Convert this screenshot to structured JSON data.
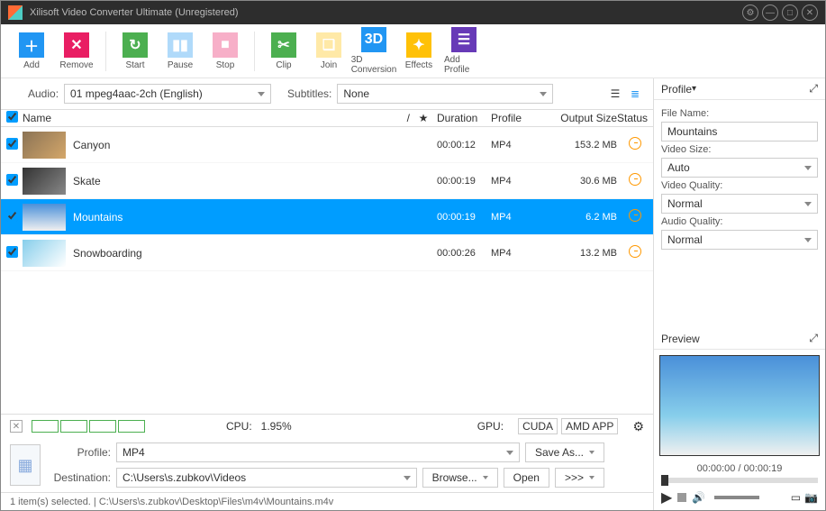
{
  "window": {
    "title": "Xilisoft Video Converter Ultimate (Unregistered)"
  },
  "toolbar": {
    "add": "Add",
    "remove": "Remove",
    "start": "Start",
    "pause": "Pause",
    "stop": "Stop",
    "clip": "Clip",
    "join": "Join",
    "threed": "3D Conversion",
    "effects": "Effects",
    "addprofile": "Add Profile"
  },
  "filters": {
    "audio_label": "Audio:",
    "audio_value": "01 mpeg4aac-2ch (English)",
    "subtitles_label": "Subtitles:",
    "subtitles_value": "None"
  },
  "columns": {
    "name": "Name",
    "path": "/",
    "star": "★",
    "duration": "Duration",
    "profile": "Profile",
    "output_size": "Output Size",
    "status": "Status"
  },
  "files": [
    {
      "name": "Canyon",
      "duration": "00:00:12",
      "profile": "MP4",
      "size": "153.2 MB",
      "selected": false,
      "checked": true
    },
    {
      "name": "Skate",
      "duration": "00:00:19",
      "profile": "MP4",
      "size": "30.6 MB",
      "selected": false,
      "checked": true
    },
    {
      "name": "Mountains",
      "duration": "00:00:19",
      "profile": "MP4",
      "size": "6.2 MB",
      "selected": true,
      "checked": true
    },
    {
      "name": "Snowboarding",
      "duration": "00:00:26",
      "profile": "MP4",
      "size": "13.2 MB",
      "selected": false,
      "checked": true
    }
  ],
  "usage": {
    "cpu_label": "CPU:",
    "cpu_value": "1.95%",
    "gpu_label": "GPU:",
    "cuda": "CUDA",
    "amd": "AMD APP"
  },
  "dest": {
    "profile_label": "Profile:",
    "profile_value": "MP4",
    "dest_label": "Destination:",
    "dest_value": "C:\\Users\\s.zubkov\\Videos",
    "saveas": "Save As...",
    "browse": "Browse...",
    "open": "Open",
    "more": ">>>"
  },
  "status": "1 item(s) selected. | C:\\Users\\s.zubkov\\Desktop\\Files\\m4v\\Mountains.m4v",
  "profile_panel": {
    "title": "Profile",
    "filename_label": "File Name:",
    "filename_value": "Mountains",
    "videosize_label": "Video Size:",
    "videosize_value": "Auto",
    "videoqual_label": "Video Quality:",
    "videoqual_value": "Normal",
    "audioqual_label": "Audio Quality:",
    "audioqual_value": "Normal"
  },
  "preview": {
    "title": "Preview",
    "time": "00:00:00 / 00:00:19"
  }
}
